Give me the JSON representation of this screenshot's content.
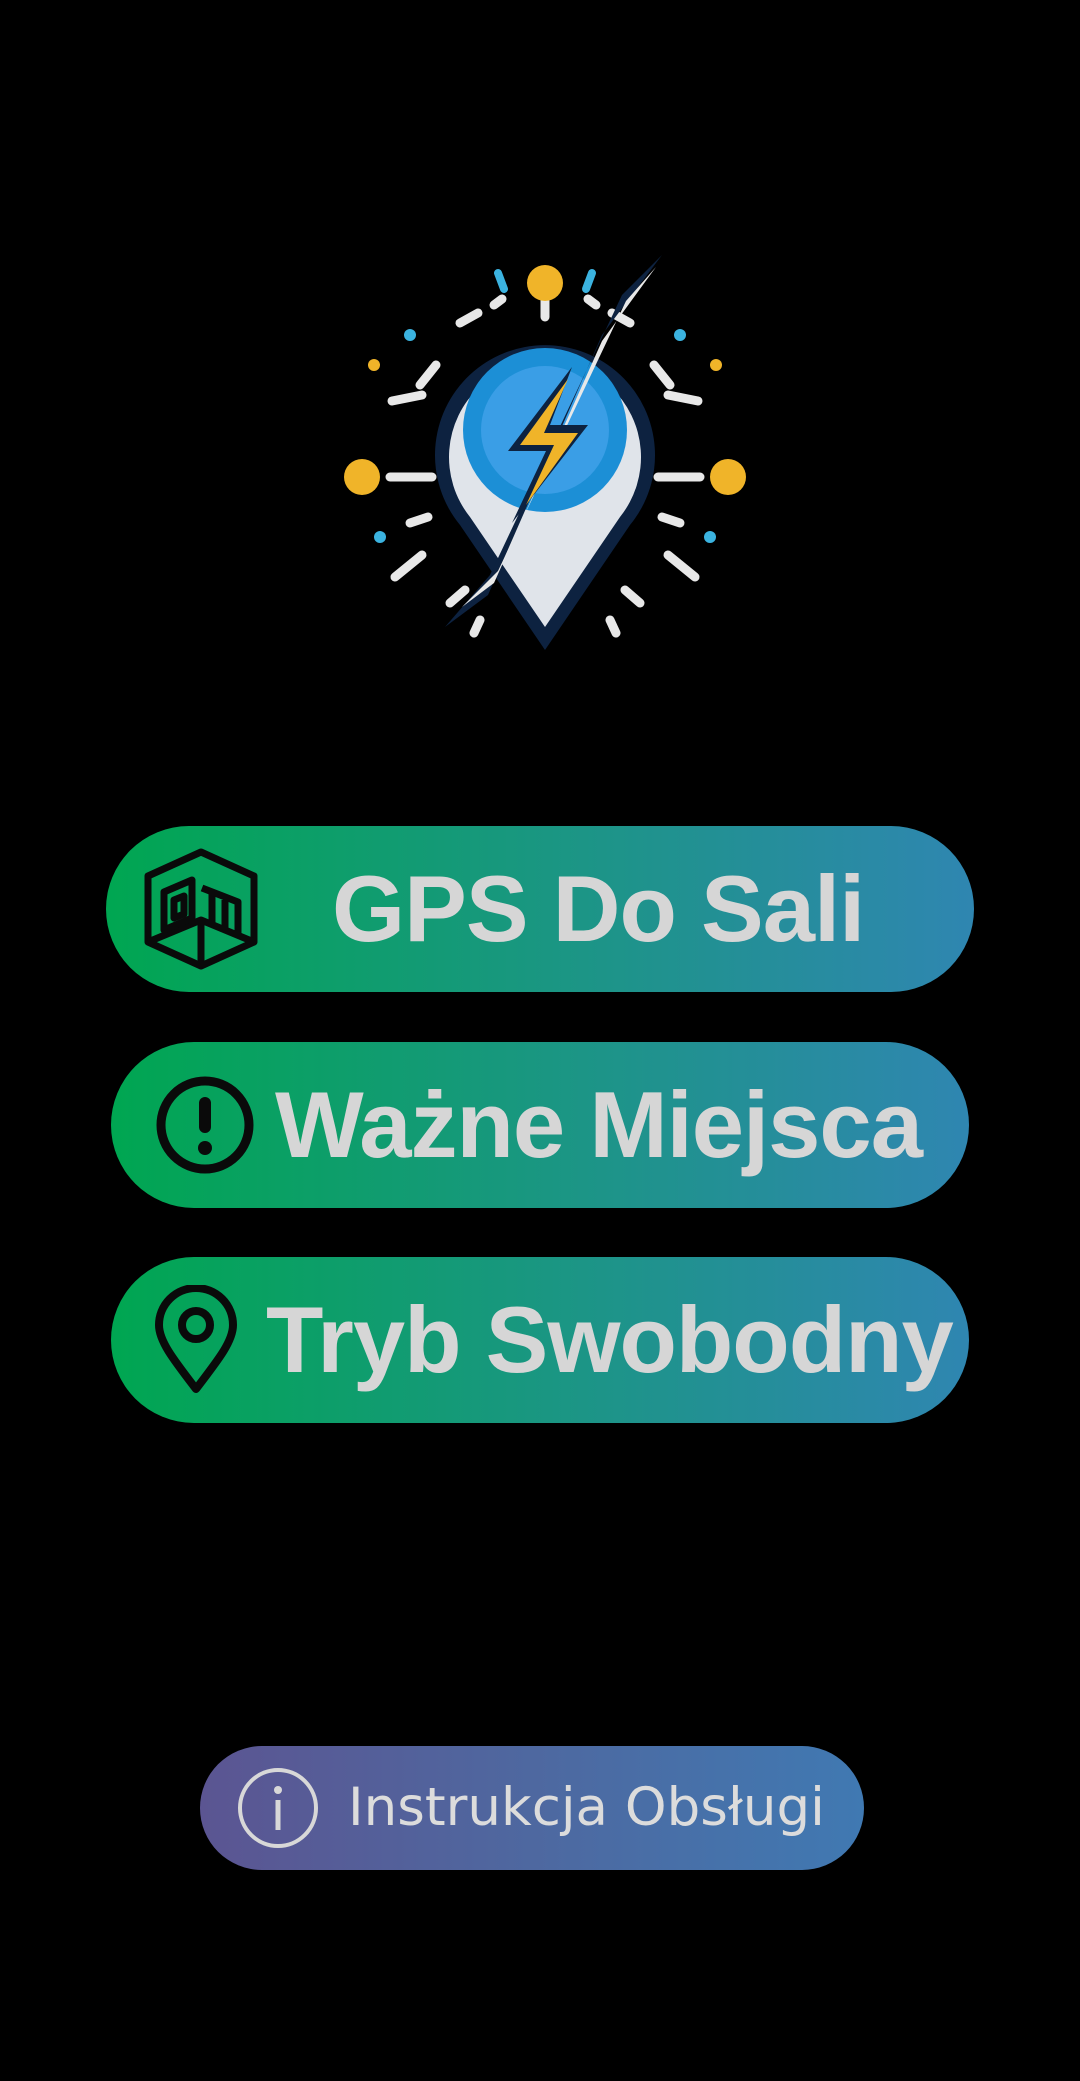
{
  "logo": {
    "icon": "location-pin-lightning-icon",
    "colors": {
      "gold": "#f0b429",
      "blue": "#1c8fd6",
      "light_blue": "#3bb3e0",
      "white": "#e8e8e8",
      "navy": "#0d2240"
    }
  },
  "menu": {
    "buttons": [
      {
        "label": "GPS Do Sali",
        "icon": "room-box-icon"
      },
      {
        "label": "Ważne Miejsca",
        "icon": "exclamation-circle-icon"
      },
      {
        "label": "Tryb Swobodny",
        "icon": "map-pin-icon"
      }
    ],
    "gradient": [
      "#00a651",
      "#2f86b1"
    ],
    "text_color": "#d6d6d6"
  },
  "help": {
    "label": "Instrukcja Obsługi",
    "icon": "info-circle-icon",
    "gradient": [
      "#5b5592",
      "#4079b2"
    ]
  }
}
